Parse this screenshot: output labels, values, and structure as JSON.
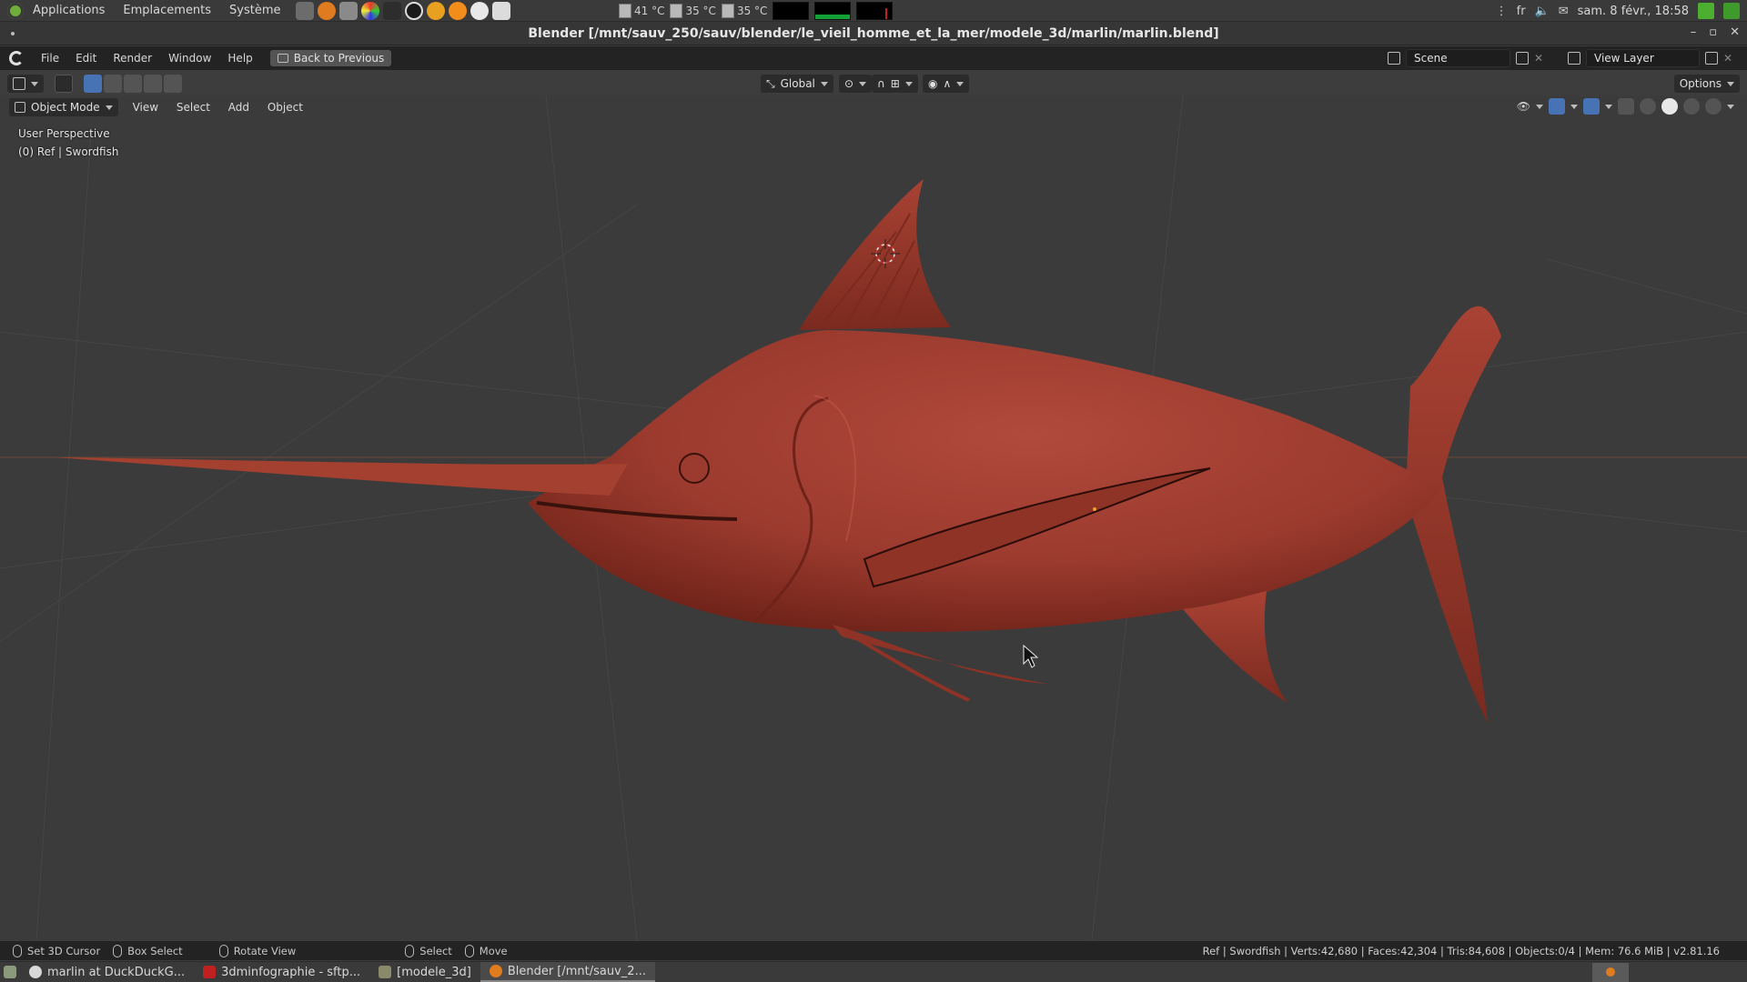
{
  "os_panel": {
    "menus": [
      "Applications",
      "Emplacements",
      "Système"
    ],
    "sensors": [
      "41 °C",
      "35 °C",
      "35 °C"
    ],
    "keyboard_layout": "fr",
    "clock": "sam. 8 févr., 18:58"
  },
  "window": {
    "title": "Blender [/mnt/sauv_250/sauv/blender/le_vieil_homme_et_la_mer/modele_3d/marlin/marlin.blend]",
    "controls": [
      "–",
      "▫",
      "✕"
    ]
  },
  "topbar": {
    "menus": [
      "File",
      "Edit",
      "Render",
      "Window",
      "Help"
    ],
    "back_button": "Back to Previous",
    "scene": "Scene",
    "view_layer": "View Layer"
  },
  "tool_header": {
    "orientation": "Global",
    "options": "Options"
  },
  "view_header": {
    "mode": "Object Mode",
    "menus": [
      "View",
      "Select",
      "Add",
      "Object"
    ]
  },
  "viewport": {
    "perspective": "User Perspective",
    "object_info": "(0) Ref | Swordfish",
    "model_color": "#9b3a2e"
  },
  "statusbar": {
    "items": [
      "Set 3D Cursor",
      "Box Select",
      "Rotate View",
      "Select",
      "Move"
    ],
    "stats": "Ref | Swordfish | Verts:42,680 | Faces:42,304 | Tris:84,608 | Objects:0/4 | Mem: 76.6 MiB | v2.81.16"
  },
  "taskbar": {
    "tasks": [
      "marlin at DuckDuckG...",
      "3dminfographie - sftp...",
      "[modele_3d]",
      "Blender [/mnt/sauv_2..."
    ]
  }
}
